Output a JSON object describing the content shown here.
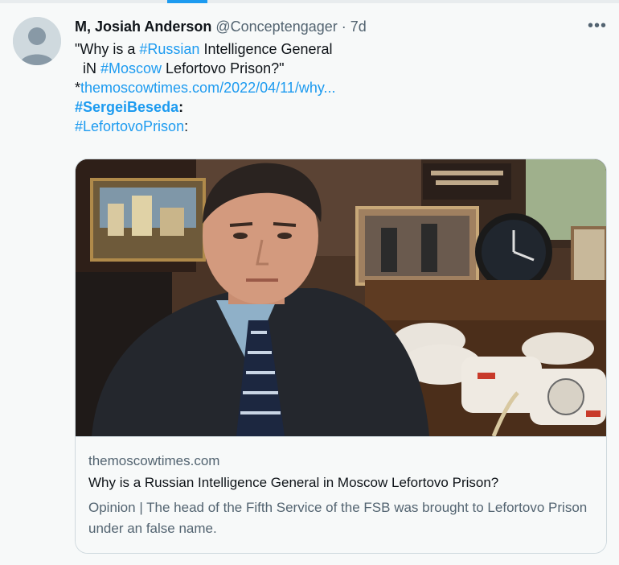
{
  "tweet": {
    "author_name": "M, Josiah Anderson",
    "handle": "@Conceptengager",
    "separator": "·",
    "time": "7d",
    "more_label": "•••",
    "text": {
      "line1_pre": "\"Why is a ",
      "line1_hashtag": "#Russian",
      "line1_post": " Intelligence General",
      "line2_pre": "  iN ",
      "line2_hashtag": "#Moscow",
      "line2_post": " Lefortovo Prison?\"",
      "line3_prefix": "*",
      "line3_link": "themoscowtimes.com/2022/04/11/why...",
      "line4_hashtag": "#SergeiBeseda",
      "line4_suffix": ":",
      "line5_hashtag": "#LefortovoPrison",
      "line5_suffix": ":"
    }
  },
  "card": {
    "domain": "themoscowtimes.com",
    "title": "Why is a Russian Intelligence General in Moscow Lefortovo Prison?",
    "description": "Opinion | The head of the Fifth Service of the FSB was brought to Lefortovo Prison under an false name."
  },
  "colors": {
    "link": "#1d9bf0",
    "text_primary": "#0f1419",
    "text_secondary": "#536471",
    "background": "#f7f9f9",
    "border": "#cfd9de"
  }
}
